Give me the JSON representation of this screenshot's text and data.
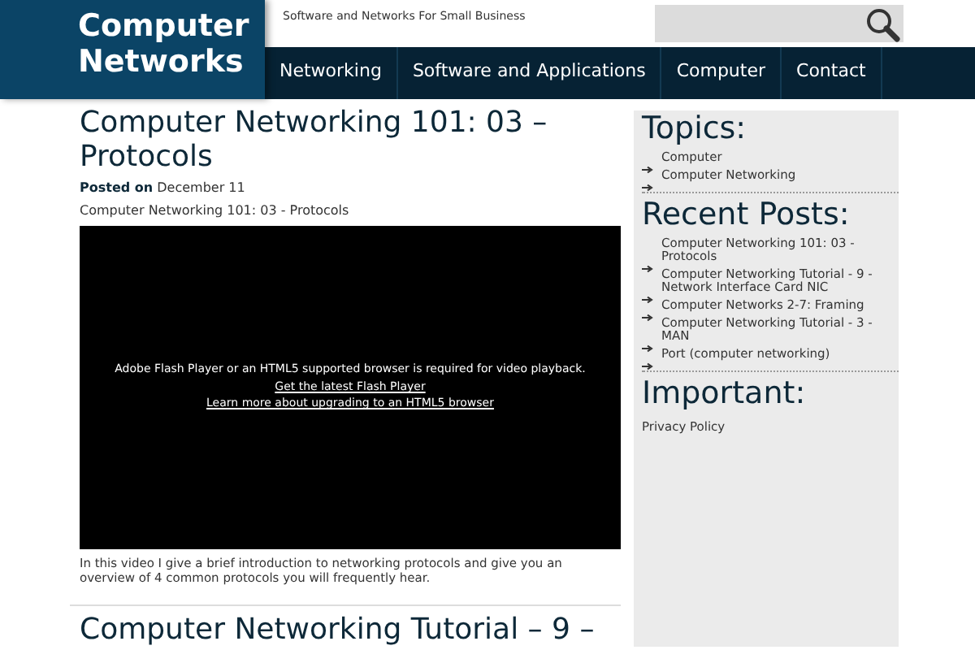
{
  "site": {
    "title": "Computer Networks",
    "tagline": "Software and Networks For Small Business"
  },
  "nav": [
    {
      "label": "Networking"
    },
    {
      "label": "Software and Applications"
    },
    {
      "label": "Computer"
    },
    {
      "label": "Contact"
    }
  ],
  "posts": [
    {
      "title": "Computer Networking 101: 03 – Protocols",
      "meta_label": "Posted on",
      "date": "December 11",
      "subtitle": "Computer Networking 101: 03 - Protocols",
      "video": {
        "message": "Adobe Flash Player or an HTML5 supported browser is required for video playback.",
        "links": [
          "Get the latest Flash Player",
          "Learn more about upgrading to an HTML5 browser"
        ]
      },
      "excerpt": "In this video I give a brief introduction to networking protocols and give you an overview of 4 common protocols you will frequently hear."
    },
    {
      "title": "Computer Networking Tutorial – 9 –"
    }
  ],
  "sidebar": [
    {
      "heading": "Topics:",
      "items": [
        "Computer",
        "Computer Networking"
      ]
    },
    {
      "heading": "Recent Posts:",
      "items": [
        "Computer Networking 101: 03 - Protocols",
        "Computer Networking Tutorial - 9 - Network Interface Card NIC",
        "Computer Networks 2-7: Framing",
        "Computer Networking Tutorial - 3 - MAN",
        "Port (computer networking)"
      ]
    },
    {
      "heading": "Important:",
      "links": [
        "Privacy Policy"
      ]
    }
  ]
}
